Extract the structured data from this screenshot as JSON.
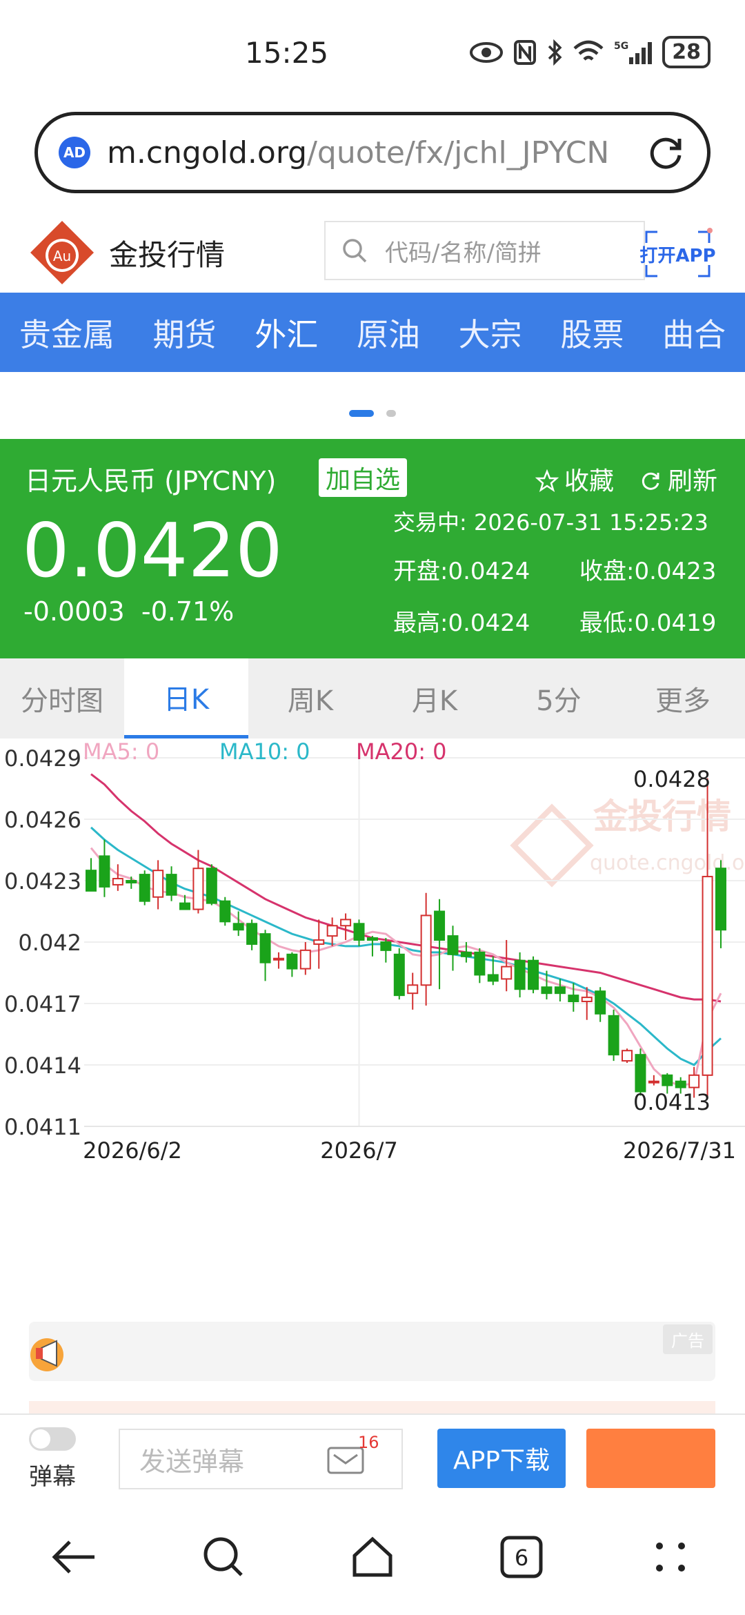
{
  "status_bar": {
    "time": "15:25",
    "battery": "28"
  },
  "browser": {
    "url_domain": "m.cngold.org",
    "url_path": "/quote/fx/jchl_JPYCN",
    "ad_badge": "AD"
  },
  "site": {
    "name": "金投行情",
    "logo_text": "Au",
    "search_placeholder": "代码/名称/简拼",
    "open_app_label": "打开APP"
  },
  "nav": {
    "items": [
      {
        "label": "贵金属"
      },
      {
        "label": "期货"
      },
      {
        "label": "外汇"
      },
      {
        "label": "原油"
      },
      {
        "label": "大宗"
      },
      {
        "label": "股票"
      },
      {
        "label": "曲合"
      }
    ],
    "active_index": 2
  },
  "quote": {
    "title": "日元人民币 (JPYCNY)",
    "add_watchlist": "加自选",
    "favorite": "收藏",
    "refresh": "刷新",
    "price": "0.0420",
    "change": "-0.0003",
    "change_pct": "-0.71%",
    "status": "交易中: 2026-07-31 15:25:23",
    "open": "开盘:0.0424",
    "close": "收盘:0.0423",
    "high": "最高:0.0424",
    "low": "最低:0.0419"
  },
  "tabs": [
    {
      "label": "分时图"
    },
    {
      "label": "日K"
    },
    {
      "label": "周K"
    },
    {
      "label": "月K"
    },
    {
      "label": "5分"
    },
    {
      "label": "更多"
    }
  ],
  "colors": {
    "up": "#d32f2f",
    "down": "#1aa31a",
    "ma5": "#f0a6c0",
    "ma10": "#2bb8c9",
    "ma20": "#d6336c",
    "accent": "#2b7be6",
    "quote_bg": "#2fab33"
  },
  "chart_data": {
    "type": "candlestick",
    "legend": [
      {
        "name": "MA5",
        "text": "MA5: 0"
      },
      {
        "name": "MA10",
        "text": "MA10: 0"
      },
      {
        "name": "MA20",
        "text": "MA20: 0"
      }
    ],
    "watermark_brand": "金投行情",
    "watermark_site": "quote.cngold.org",
    "y_ticks": [
      "0.0429",
      "0.0426",
      "0.0423",
      "0.042",
      "0.0417",
      "0.0414",
      "0.0411"
    ],
    "ylim": [
      0.0411,
      0.0429
    ],
    "x_labels": [
      "2026/6/2",
      "2026/7",
      "2026/7/31"
    ],
    "max_label": "0.0428",
    "min_label": "0.0413",
    "candles": [
      {
        "o": 0.04235,
        "h": 0.04241,
        "l": 0.04227,
        "c": 0.04225
      },
      {
        "o": 0.04242,
        "h": 0.0425,
        "l": 0.04222,
        "c": 0.04227
      },
      {
        "o": 0.04228,
        "h": 0.04238,
        "l": 0.04225,
        "c": 0.04231
      },
      {
        "o": 0.0423,
        "h": 0.04232,
        "l": 0.04226,
        "c": 0.04229
      },
      {
        "o": 0.04233,
        "h": 0.04235,
        "l": 0.04218,
        "c": 0.0422
      },
      {
        "o": 0.04222,
        "h": 0.0424,
        "l": 0.04216,
        "c": 0.04235
      },
      {
        "o": 0.04233,
        "h": 0.04237,
        "l": 0.0422,
        "c": 0.04223
      },
      {
        "o": 0.04219,
        "h": 0.04223,
        "l": 0.04216,
        "c": 0.04216
      },
      {
        "o": 0.04216,
        "h": 0.04245,
        "l": 0.04214,
        "c": 0.04236
      },
      {
        "o": 0.04236,
        "h": 0.04238,
        "l": 0.04218,
        "c": 0.04219
      },
      {
        "o": 0.0422,
        "h": 0.04222,
        "l": 0.04208,
        "c": 0.0421
      },
      {
        "o": 0.04209,
        "h": 0.04215,
        "l": 0.04203,
        "c": 0.04206
      },
      {
        "o": 0.04209,
        "h": 0.04211,
        "l": 0.04196,
        "c": 0.04199
      },
      {
        "o": 0.04204,
        "h": 0.04206,
        "l": 0.04181,
        "c": 0.0419
      },
      {
        "o": 0.04192,
        "h": 0.04195,
        "l": 0.04187,
        "c": 0.04192
      },
      {
        "o": 0.04194,
        "h": 0.04195,
        "l": 0.04183,
        "c": 0.04187
      },
      {
        "o": 0.04187,
        "h": 0.042,
        "l": 0.04184,
        "c": 0.04196
      },
      {
        "o": 0.04199,
        "h": 0.04211,
        "l": 0.04187,
        "c": 0.04201
      },
      {
        "o": 0.04203,
        "h": 0.04212,
        "l": 0.04198,
        "c": 0.04208
      },
      {
        "o": 0.04208,
        "h": 0.04214,
        "l": 0.04201,
        "c": 0.04211
      },
      {
        "o": 0.04209,
        "h": 0.04211,
        "l": 0.04198,
        "c": 0.04201
      },
      {
        "o": 0.04202,
        "h": 0.04203,
        "l": 0.04193,
        "c": 0.04201
      },
      {
        "o": 0.042,
        "h": 0.04202,
        "l": 0.0419,
        "c": 0.04196
      },
      {
        "o": 0.04194,
        "h": 0.04197,
        "l": 0.04172,
        "c": 0.04174
      },
      {
        "o": 0.04175,
        "h": 0.04185,
        "l": 0.04167,
        "c": 0.04179
      },
      {
        "o": 0.04179,
        "h": 0.04224,
        "l": 0.04169,
        "c": 0.04213
      },
      {
        "o": 0.04215,
        "h": 0.04221,
        "l": 0.04177,
        "c": 0.04201
      },
      {
        "o": 0.04203,
        "h": 0.04208,
        "l": 0.04186,
        "c": 0.04194
      },
      {
        "o": 0.04195,
        "h": 0.042,
        "l": 0.0419,
        "c": 0.04193
      },
      {
        "o": 0.04195,
        "h": 0.04197,
        "l": 0.0418,
        "c": 0.04184
      },
      {
        "o": 0.04184,
        "h": 0.04193,
        "l": 0.04179,
        "c": 0.04181
      },
      {
        "o": 0.04182,
        "h": 0.04201,
        "l": 0.04176,
        "c": 0.04188
      },
      {
        "o": 0.04191,
        "h": 0.04195,
        "l": 0.04173,
        "c": 0.04177
      },
      {
        "o": 0.04191,
        "h": 0.04193,
        "l": 0.04175,
        "c": 0.04177
      },
      {
        "o": 0.04178,
        "h": 0.04186,
        "l": 0.04172,
        "c": 0.04175
      },
      {
        "o": 0.04178,
        "h": 0.04182,
        "l": 0.04171,
        "c": 0.04175
      },
      {
        "o": 0.04174,
        "h": 0.0418,
        "l": 0.04166,
        "c": 0.04171
      },
      {
        "o": 0.04171,
        "h": 0.04178,
        "l": 0.04162,
        "c": 0.04173
      },
      {
        "o": 0.04176,
        "h": 0.04178,
        "l": 0.04161,
        "c": 0.04165
      },
      {
        "o": 0.04164,
        "h": 0.04167,
        "l": 0.04142,
        "c": 0.04145
      },
      {
        "o": 0.04142,
        "h": 0.04148,
        "l": 0.04141,
        "c": 0.04147
      },
      {
        "o": 0.04145,
        "h": 0.04148,
        "l": 0.04125,
        "c": 0.04127
      },
      {
        "o": 0.04132,
        "h": 0.04135,
        "l": 0.0413,
        "c": 0.04132
      },
      {
        "o": 0.04135,
        "h": 0.04136,
        "l": 0.04126,
        "c": 0.0413
      },
      {
        "o": 0.04132,
        "h": 0.04134,
        "l": 0.04126,
        "c": 0.04129
      },
      {
        "o": 0.04129,
        "h": 0.04139,
        "l": 0.04124,
        "c": 0.04135
      },
      {
        "o": 0.04135,
        "h": 0.0428,
        "l": 0.04124,
        "c": 0.04232
      },
      {
        "o": 0.04236,
        "h": 0.0424,
        "l": 0.04197,
        "c": 0.04206
      }
    ],
    "ma5": [
      0.04246,
      0.04238,
      0.04233,
      0.04231,
      0.04227,
      0.04225,
      0.04224,
      0.04222,
      0.04221,
      0.0422,
      0.04216,
      0.04211,
      0.04206,
      0.04202,
      0.04198,
      0.04196,
      0.04195,
      0.04196,
      0.04198,
      0.042,
      0.04203,
      0.04205,
      0.04204,
      0.04199,
      0.04194,
      0.04193,
      0.04194,
      0.04197,
      0.04198,
      0.04196,
      0.04194,
      0.0419,
      0.04187,
      0.04184,
      0.04181,
      0.04179,
      0.04177,
      0.04176,
      0.04173,
      0.04168,
      0.0416,
      0.04149,
      0.04138,
      0.04132,
      0.0413,
      0.04131,
      0.04162,
      0.04175
    ],
    "ma10": [
      0.04256,
      0.0425,
      0.04245,
      0.04241,
      0.04237,
      0.04233,
      0.04229,
      0.04226,
      0.04224,
      0.04222,
      0.04219,
      0.04216,
      0.04213,
      0.0421,
      0.04207,
      0.04204,
      0.04202,
      0.042,
      0.04199,
      0.04198,
      0.04198,
      0.04199,
      0.04199,
      0.04198,
      0.04196,
      0.04195,
      0.04195,
      0.04194,
      0.04193,
      0.04192,
      0.04191,
      0.0419,
      0.04188,
      0.04186,
      0.04184,
      0.04182,
      0.0418,
      0.04177,
      0.04174,
      0.0417,
      0.04165,
      0.0416,
      0.04154,
      0.04148,
      0.04143,
      0.0414,
      0.04147,
      0.04153
    ],
    "ma20": [
      0.04282,
      0.04277,
      0.0427,
      0.04264,
      0.04259,
      0.04253,
      0.04248,
      0.04244,
      0.0424,
      0.04237,
      0.04233,
      0.04229,
      0.04225,
      0.04221,
      0.04218,
      0.04215,
      0.04212,
      0.0421,
      0.04208,
      0.04206,
      0.04204,
      0.04202,
      0.04201,
      0.042,
      0.04199,
      0.04198,
      0.04197,
      0.04196,
      0.04195,
      0.04194,
      0.04193,
      0.04192,
      0.04191,
      0.0419,
      0.04189,
      0.04188,
      0.04187,
      0.04186,
      0.04185,
      0.04183,
      0.04181,
      0.04179,
      0.04177,
      0.04175,
      0.04173,
      0.04172,
      0.04172,
      0.04171
    ]
  },
  "ad": {
    "tag": "广告"
  },
  "bottom": {
    "danmu_label": "弹幕",
    "danmu_placeholder": "发送弹幕",
    "msg_count": "16",
    "app_download": "APP下载"
  },
  "sys_nav": {
    "tabs_count": "6"
  }
}
